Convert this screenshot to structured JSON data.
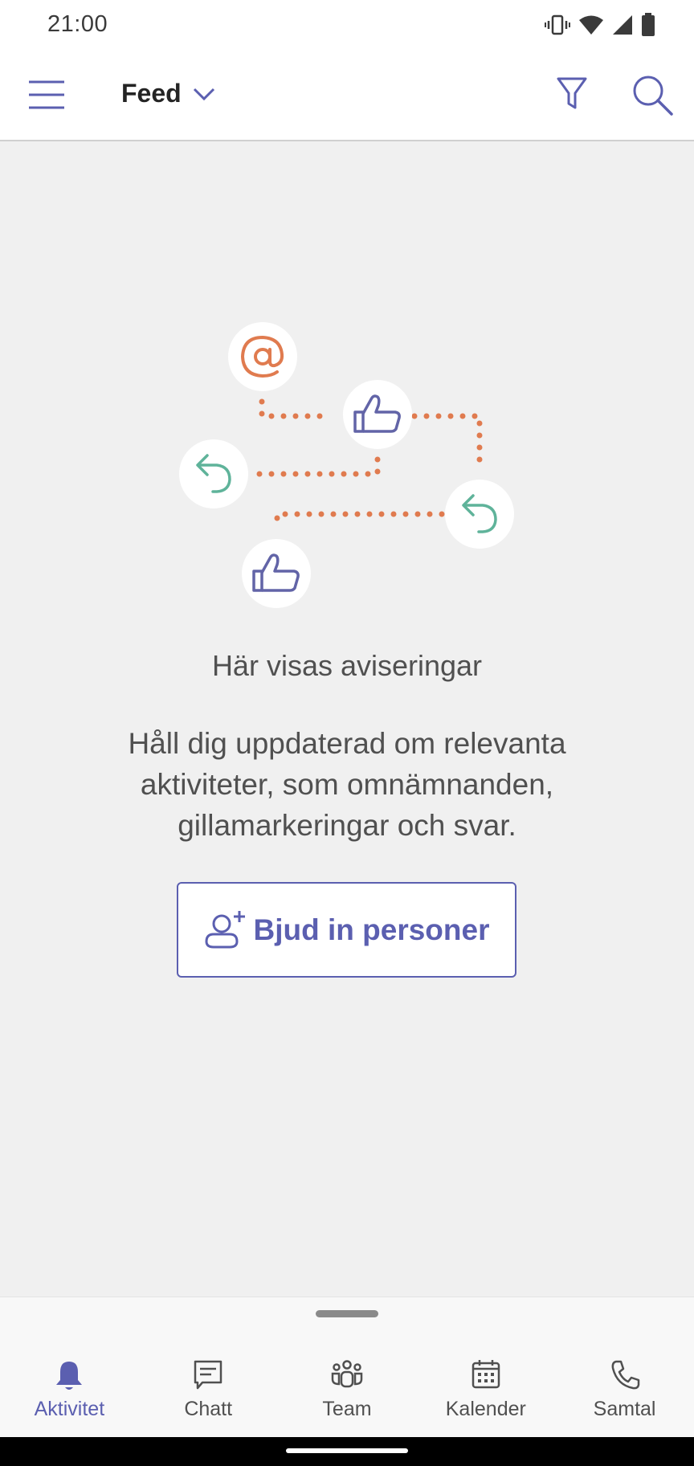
{
  "status_bar": {
    "time": "21:00",
    "icons": [
      "vibrate-icon",
      "wifi-icon",
      "signal-icon",
      "battery-icon"
    ]
  },
  "header": {
    "title": "Feed",
    "icons": [
      "menu-icon",
      "chevron-down-icon",
      "filter-icon",
      "search-icon"
    ]
  },
  "empty_state": {
    "title": "Här visas aviseringar",
    "description": "Håll dig uppdaterad om relevanta aktiviteter, som omnämnanden, gillamarkeringar och svar.",
    "button_label": "Bjud in personer",
    "button_icon": "add-person-icon"
  },
  "bottom_nav": {
    "items": [
      {
        "label": "Aktivitet",
        "icon": "bell-icon",
        "active": true
      },
      {
        "label": "Chatt",
        "icon": "chat-icon",
        "active": false
      },
      {
        "label": "Team",
        "icon": "team-icon",
        "active": false
      },
      {
        "label": "Kalender",
        "icon": "calendar-icon",
        "active": false
      },
      {
        "label": "Samtal",
        "icon": "phone-icon",
        "active": false
      }
    ]
  },
  "colors": {
    "accent": "#5b5fb0",
    "illustration_orange": "#e07b4f",
    "illustration_green": "#5fb39a",
    "background": "#f0f0f0"
  }
}
